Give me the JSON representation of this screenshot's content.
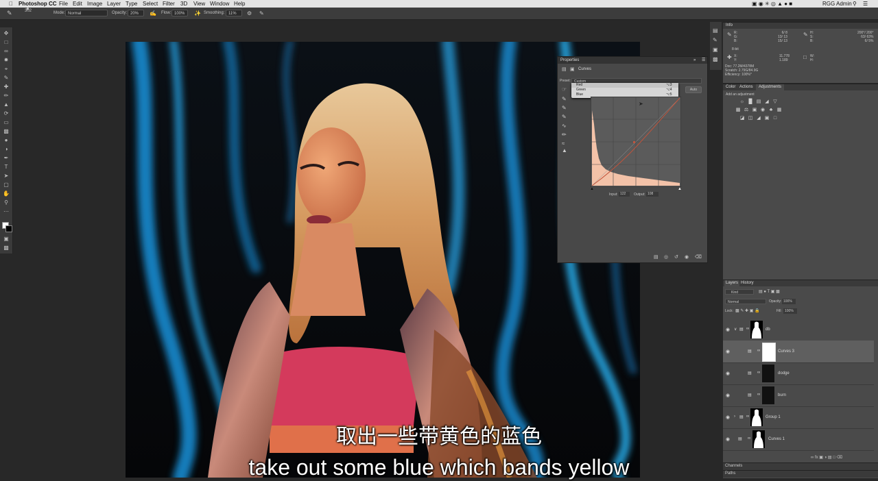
{
  "menubar": {
    "app": "Photoshop CC",
    "items": [
      "File",
      "Edit",
      "Image",
      "Layer",
      "Type",
      "Select",
      "Filter",
      "3D",
      "View",
      "Window",
      "Help"
    ],
    "user": "RGG Admin"
  },
  "options": {
    "brush_size": "302",
    "mode_label": "Mode:",
    "mode_value": "Normal",
    "opacity_label": "Opacity:",
    "opacity_value": "20%",
    "flow_label": "Flow:",
    "flow_value": "100%",
    "smoothing_label": "Smoothing:",
    "smoothing_value": "11%"
  },
  "info": {
    "title": "Info",
    "r_label": "R:",
    "g_label": "G:",
    "b_label": "B:",
    "r_vals": "6/  8",
    "g_vals": "13/  13",
    "b_vals": "15/  13",
    "h_label": "H:",
    "s_label": "S:",
    "bb_label": "B:",
    "h_vals": "200°/ 200°",
    "s_vals": "63/  63%",
    "b2_vals": "6/  5%",
    "bit": "8-bit",
    "x_label": "X:",
    "y_label": "Y:",
    "x_val": "11.778",
    "y_val": "1.189",
    "w_label": "W:",
    "hh_label": "H:",
    "doc": "Doc: 77.2M/4378M",
    "scratch": "Scratch: 2.79G/84.9G",
    "efficiency": "Efficiency: 100%*"
  },
  "adjustments": {
    "tabs": [
      "Color",
      "Actions",
      "Adjustments"
    ],
    "add_label": "Add an adjustment"
  },
  "properties": {
    "title": "Properties",
    "panel_name": "Curves",
    "preset_label": "Preset:",
    "preset_value": "Custom",
    "auto_label": "Auto",
    "channels": [
      {
        "name": "Red",
        "shortcut": "⌥3"
      },
      {
        "name": "Green",
        "shortcut": "⌥4"
      },
      {
        "name": "Blue",
        "shortcut": "⌥5"
      }
    ],
    "input_label": "Input:",
    "input_value": "122",
    "output_label": "Output:",
    "output_value": "108"
  },
  "layers": {
    "tabs": [
      "Layers",
      "History"
    ],
    "filter_value": "Kind",
    "blend_mode": "Normal",
    "opacity_label": "Opacity:",
    "opacity_value": "100%",
    "lock_label": "Lock:",
    "fill_label": "Fill:",
    "fill_value": "100%",
    "rows": [
      {
        "name": "db"
      },
      {
        "name": "Curves 3"
      },
      {
        "name": "dodge"
      },
      {
        "name": "burn"
      },
      {
        "name": "Group 1"
      },
      {
        "name": "Curves 1"
      }
    ],
    "bottom_tabs": [
      "Channels",
      "Paths"
    ]
  },
  "subtitles": {
    "zh": "取出一些带黄色的蓝色",
    "en": "take out some blue which bands yellow"
  },
  "colors": {
    "menubar_bg": "#e3e3e3",
    "panel_bg": "#4a4a4a",
    "app_bg": "#282828",
    "accent_blue": "#1aa3ff",
    "curve_line": "#c0543c"
  }
}
